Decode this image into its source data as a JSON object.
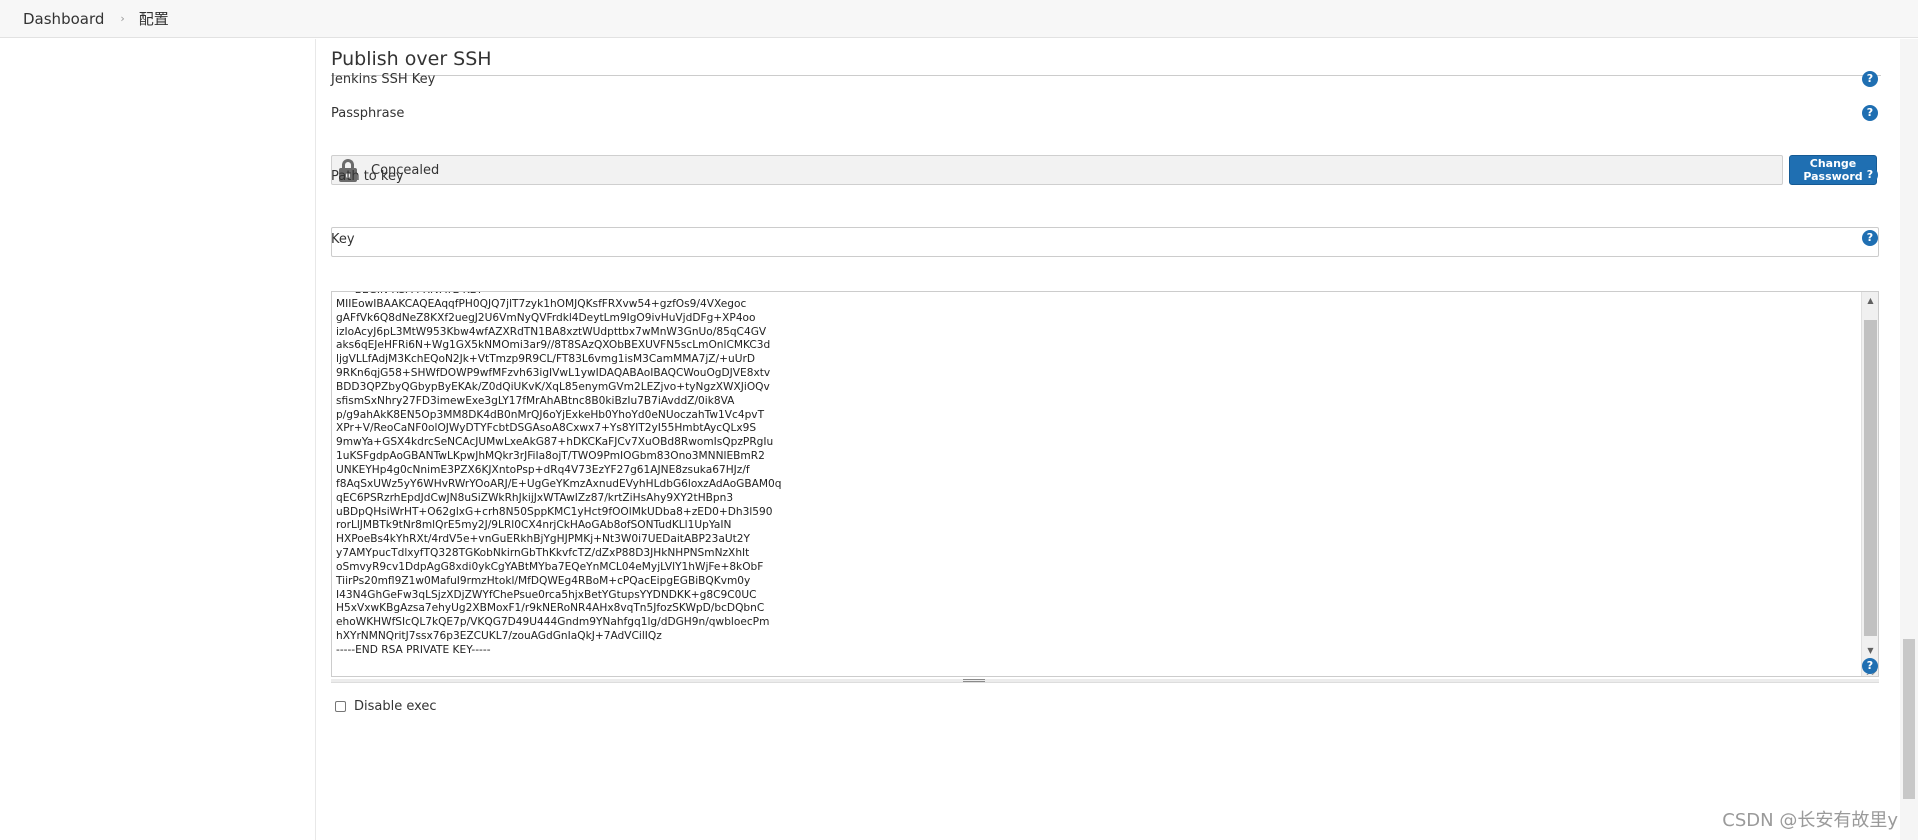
{
  "breadcrumb": {
    "items": [
      "Dashboard",
      "配置"
    ],
    "separator": "›"
  },
  "section": {
    "title": "Publish over SSH"
  },
  "fields": {
    "jenkins_ssh_key_label": "Jenkins SSH Key",
    "passphrase_label": "Passphrase",
    "passphrase_value": "Concealed",
    "change_password_label": "Change Password",
    "path_to_key_label": "Path to key",
    "path_to_key_value": "",
    "key_label": "Key",
    "key_value": "-----BEGIN RSA PRIVATE KEY-----\nMIIEowIBAAKCAQEAqqfPH0QJQ7jlT7zyk1hOMJQKsfFRXvw54+gzfOs9/4VXegoc\ngAFfVk6Q8dNeZ8KXf2uegJ2U6VmNyQVFrdkl4DeytLm9IgO9ivHuVjdDFg+XP4oo\nizIoAcyJ6pL3MtW953Kbw4wfAZXRdTN1BA8xztWUdpttbx7wMnW3GnUo/85qC4GV\naks6qEJeHFRi6N+Wg1GX5kNMOmi3ar9//8T8SAzQXObBEXUVFN5scLmOnlCMKC3d\nljgVLLfAdjM3KchEQoN2Jk+VtTmzp9R9CL/FT83L6vmg1isM3CamMMA7jZ/+uUrD\n9RKn6qjG58+SHWfDOWP9wfMFzvh63igIVwL1ywIDAQABAoIBAQCWouOgDJVE8xtv\nBDD3QPZbyQGbypByEKAk/Z0dQiUKvK/XqL85enymGVm2LEZjvo+tyNgzXWXJiOQv\nsfismSxNhry27FD3imewExe3gLY17fMrAhABtnc8B0kiBzIu7B7iAvddZ/0ik8VA\np/g9ahAkK8EN5Op3MM8DK4dB0nMrQJ6oYjExkeHb0YhoYd0eNUoczahTw1Vc4pvT\nXPr+V/ReoCaNF0olOJWyDTYFcbtDSGAsoA8Cxwx7+Ys8YIT2yI55HmbtAycQLx9S\n9mwYa+GSX4kdrcSeNCAcJUMwLxeAkG87+hDKCKaFJCv7XuOBd8RwomIsQpzPRgIu\n1uKSFgdpAoGBANTwLKpwJhMQkr3rJFiIa8ojT/TWO9PmIOGbm83Ono3MNNlEBmR2\nUNKEYHp4g0cNnimE3PZX6KJXntoPsp+dRq4V73EzYF27g61AJNE8zsuka67HJz/f\nf8AqSxUWz5yY6WHvRWrYOoARJ/E+UgGeYKmzAxnudEVyhHLdbG6loxzAdAoGBAM0q\nqEC6PSRzrhEpdJdCwJN8uSiZWkRhJkijJxWTAwIZz87/krtZiHsAhy9XY2tHBpn3\nuBDpQHsiWrHT+O62glxG+crh8N50SppKMC1yHct9fOOlMkUDba8+zED0+Dh3l590\nrorLlJMBTk9tNr8mlQrE5my2J/9LRl0CX4nrjCkHAoGAb8ofSONTudKLl1UpYaIN\nHXPoeBs4kYhRXt/4rdV5e+vnGuERkhBjYgHJPMKj+Nt3W0i7UEDaitABP23aUt2Y\ny7AMYpucTdlxyfTQ328TGKobNkirnGbThKkvfcTZ/dZxP88D3JHkNHPNSmNzXhIt\noSmvyR9cv1DdpAgG8xdi0ykCgYABtMYba7EQeYnMCL04eMyjLVlY1hWjFe+8kObF\nTiirPs20mfl9Z1w0MafuI9rmzHtokl/MfDQWEg4RBoM+cPQacEipgEGBiBQKvm0y\nI43N4GhGeFw3qLSjzXDjZWYfChePsue0rca5hjxBetYGtupsYYDNDKK+g8C9C0UC\nH5xVxwKBgAzsa7ehyUg2XBMoxF1/r9kNERoNR4AHx8vqTn5JfozSKWpD/bcDQbnC\nehoWKHWfSIcQL7kQE7p/VKQG7D49U444Gndm9YNahfgq1lg/dDGH9n/qwbloecPm\nhXYrNMNQritJ7ssx76p3EZCUKL7/zouAGdGnIaQkJ+7AdVCilIQz\n-----END RSA PRIVATE KEY-----",
    "disable_exec_label": "Disable exec",
    "disable_exec_checked": false
  },
  "help_icon_glyph": "?",
  "icons": {
    "lock": "lock-icon",
    "help": "help-icon",
    "scroll_up": "▲",
    "scroll_down": "▼"
  },
  "colors": {
    "accent": "#1f6fb2",
    "breadcrumb_bg": "#f7f7f7",
    "concealed_bg": "#f2f2f2"
  },
  "watermark": "CSDN @长安有故里y"
}
